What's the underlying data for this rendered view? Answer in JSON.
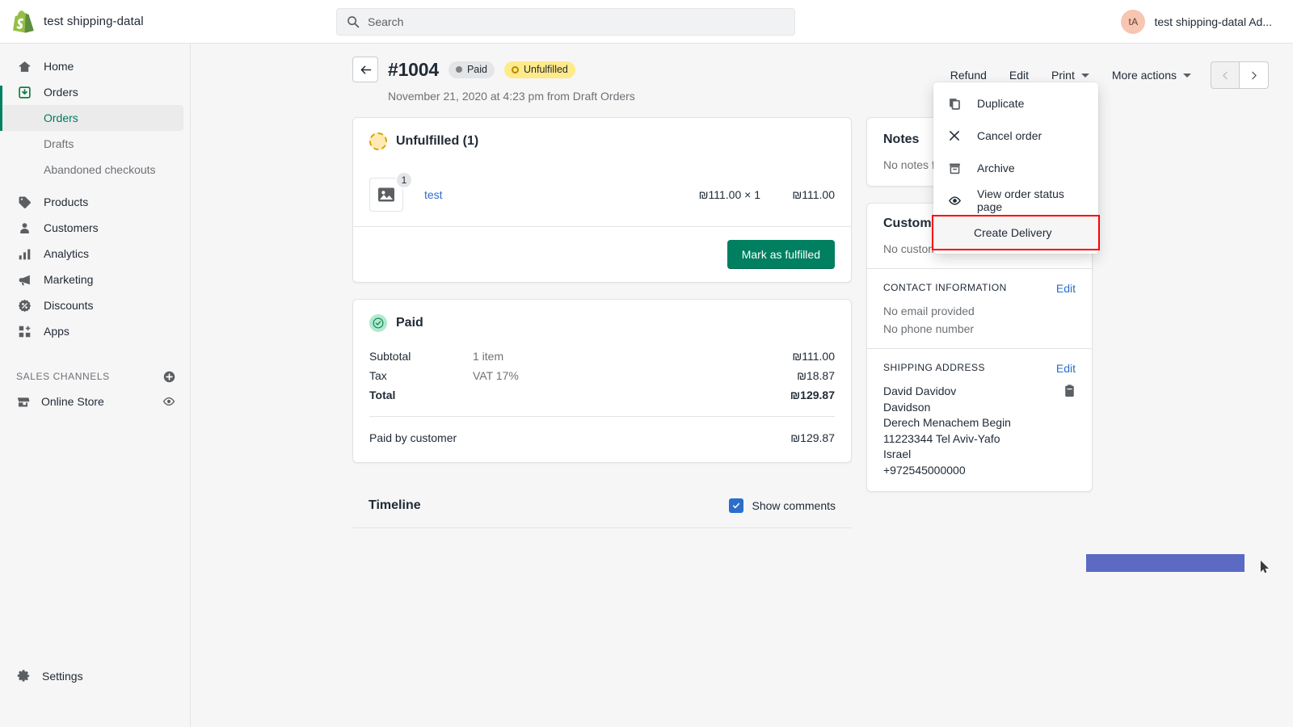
{
  "topbar": {
    "shop_name": "test shipping-datal",
    "logo_icon": "shopify-logo",
    "search": {
      "placeholder": "Search",
      "icon": "search-icon"
    },
    "account": {
      "initials": "tA",
      "name": "test shipping-datal Ad..."
    }
  },
  "sidebar": {
    "items": [
      {
        "label": "Home",
        "icon": "home-icon"
      },
      {
        "label": "Orders",
        "icon": "orders-icon"
      },
      {
        "label": "Orders",
        "icon": "",
        "sub": true,
        "active": true
      },
      {
        "label": "Drafts",
        "icon": "",
        "sub": true,
        "active": false
      },
      {
        "label": "Abandoned checkouts",
        "icon": "",
        "sub": true,
        "active": false
      },
      {
        "label": "Products",
        "icon": "products-icon"
      },
      {
        "label": "Customers",
        "icon": "customers-icon"
      },
      {
        "label": "Analytics",
        "icon": "analytics-icon"
      },
      {
        "label": "Marketing",
        "icon": "marketing-icon"
      },
      {
        "label": "Discounts",
        "icon": "discounts-icon"
      },
      {
        "label": "Apps",
        "icon": "apps-icon"
      }
    ],
    "sales_channels": {
      "label": "SALES CHANNELS",
      "add_icon": "plus-circle-icon",
      "channels": [
        {
          "label": "Online Store",
          "icon": "store-icon",
          "action_icon": "eye-icon"
        }
      ]
    },
    "settings": {
      "label": "Settings",
      "icon": "gear-icon"
    }
  },
  "order": {
    "back_icon": "arrow-left-icon",
    "number": "#1004",
    "badges": [
      {
        "label": "Paid",
        "style": "grey"
      },
      {
        "label": "Unfulfilled",
        "style": "yellow"
      }
    ],
    "subtitle": "November 21, 2020 at 4:23 pm from Draft Orders",
    "actions": [
      {
        "label": "Refund",
        "caret": false
      },
      {
        "label": "Edit",
        "caret": false
      },
      {
        "label": "Print",
        "caret": true
      },
      {
        "label": "More actions",
        "caret": true
      }
    ],
    "pager": {
      "prev_icon": "chevron-left-icon",
      "next_icon": "chevron-right-icon"
    }
  },
  "more_actions_menu": {
    "items": [
      {
        "label": "Duplicate",
        "icon": "duplicate-icon",
        "highlight": false
      },
      {
        "label": "Cancel order",
        "icon": "close-x-icon",
        "highlight": false
      },
      {
        "label": "Archive",
        "icon": "archive-icon",
        "highlight": false
      },
      {
        "label": "View order status page",
        "icon": "eye-icon",
        "highlight": false
      },
      {
        "label": "Create Delivery",
        "icon": "",
        "highlight": true
      }
    ],
    "highlight_color": "#ff0000"
  },
  "fulfillment_card": {
    "status_icon": "unfulfilled-ring-icon",
    "title": "Unfulfilled (1)",
    "item": {
      "thumb_icon": "image-placeholder-icon",
      "quantity_badge": "1",
      "name": "test",
      "unit_price": "₪111.00 × 1",
      "line_total": "₪111.00"
    },
    "primary_button": "Mark as fulfilled"
  },
  "payment_card": {
    "status_icon": "check-circle-icon",
    "title": "Paid",
    "rows": [
      {
        "label": "Subtotal",
        "detail": "1 item",
        "value": "₪111.00",
        "bold": false
      },
      {
        "label": "Tax",
        "detail": "VAT 17%",
        "value": "₪18.87",
        "bold": false
      },
      {
        "label": "Total",
        "detail": "",
        "value": "₪129.87",
        "bold": true
      }
    ],
    "paid_row": {
      "label": "Paid by customer",
      "value": "₪129.87"
    }
  },
  "timeline_card": {
    "title": "Timeline",
    "show_comments_label": "Show comments",
    "show_comments_checked": true
  },
  "notes_card": {
    "title": "Notes",
    "body": "No notes f"
  },
  "customer_card": {
    "title": "Custome",
    "body": "No customer",
    "contact": {
      "label": "CONTACT INFORMATION",
      "edit": "Edit",
      "email": "No email provided",
      "phone": "No phone number"
    },
    "shipping": {
      "label": "SHIPPING ADDRESS",
      "edit": "Edit",
      "copy_icon": "clipboard-icon",
      "lines": [
        "David Davidov",
        "Davidson",
        "Derech Menachem Begin",
        "11223344 Tel Aviv-Yafo",
        "Israel",
        "+972545000000"
      ]
    }
  },
  "colors": {
    "brand_green": "#008060",
    "accent_blue": "#2c6ecb",
    "warning_yellow": "#ffea8a",
    "highlight_red": "#ff0000",
    "purple_bar": "#5c6ac4"
  }
}
